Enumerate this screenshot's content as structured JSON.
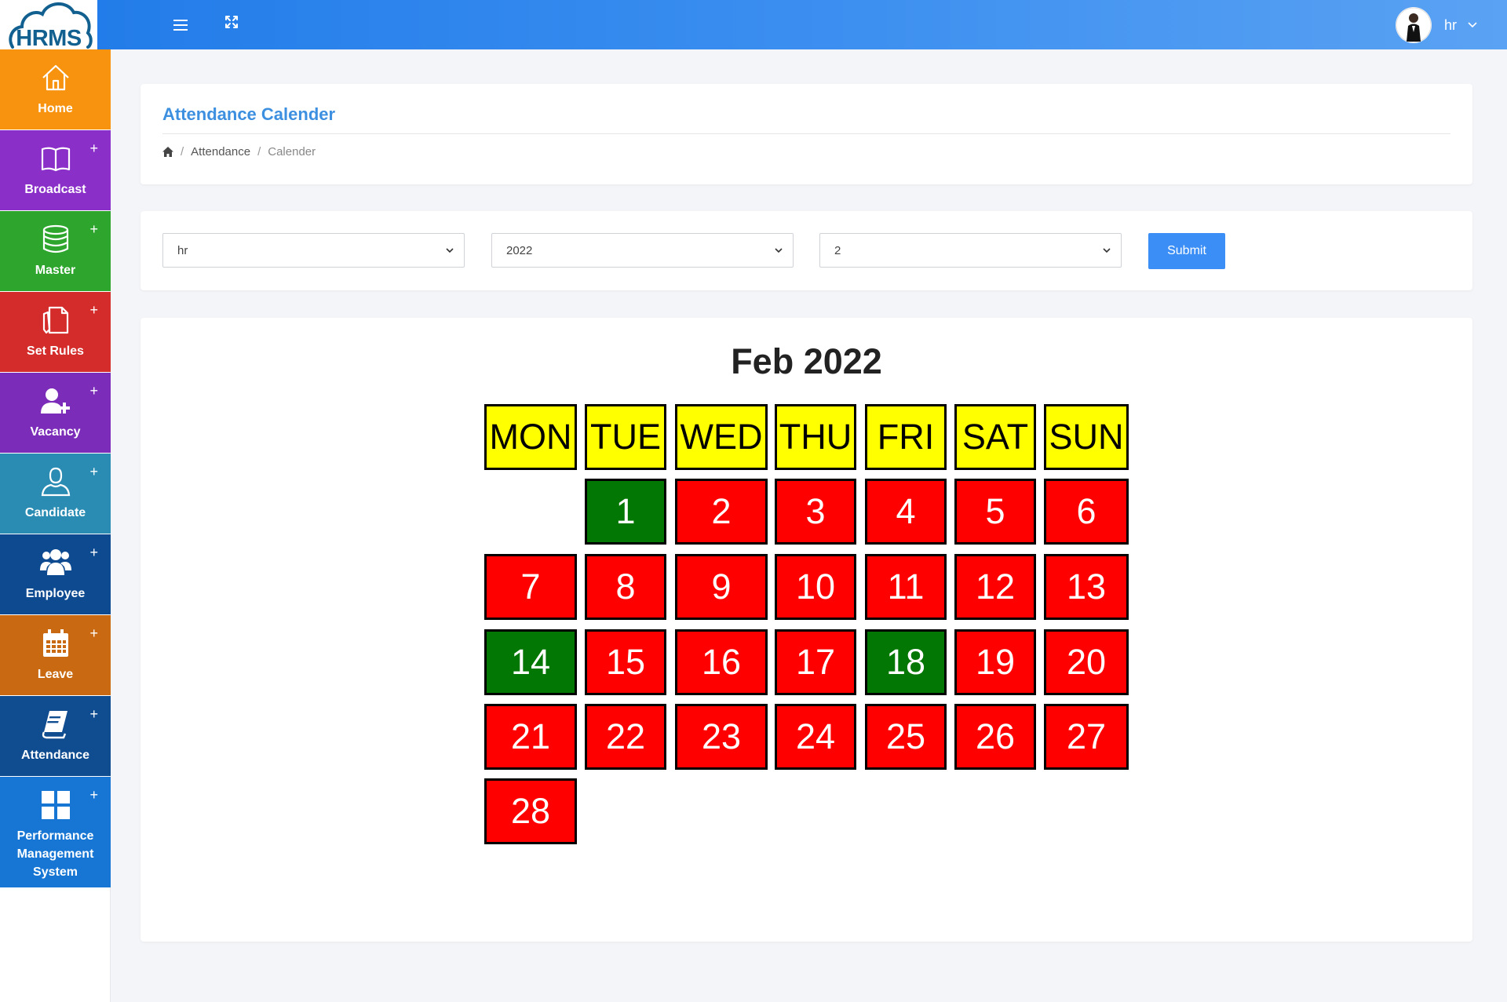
{
  "brand": {
    "logo_text": "HRMS"
  },
  "topbar": {
    "menu_icon": "hamburger-icon",
    "fullscreen_icon": "expand-icon",
    "user_name": "hr",
    "user_caret_icon": "chevron-down-icon"
  },
  "sidebar": {
    "items": [
      {
        "label": "Home",
        "icon": "home-icon",
        "color": "#f7930f",
        "expandable": false
      },
      {
        "label": "Broadcast",
        "icon": "book-icon",
        "color": "#8b2fc9",
        "expandable": true
      },
      {
        "label": "Master",
        "icon": "database-icon",
        "color": "#2ea62e",
        "expandable": true
      },
      {
        "label": "Set Rules",
        "icon": "rules-icon",
        "color": "#d42b2b",
        "expandable": true
      },
      {
        "label": "Vacancy",
        "icon": "user-plus-icon",
        "color": "#7b2cb8",
        "expandable": true
      },
      {
        "label": "Candidate",
        "icon": "user-icon",
        "color": "#2a8cb3",
        "expandable": true
      },
      {
        "label": "Employee",
        "icon": "users-icon",
        "color": "#0e4a8f",
        "expandable": true
      },
      {
        "label": "Leave",
        "icon": "calendar-icon",
        "color": "#c96a12",
        "expandable": true
      },
      {
        "label": "Attendance",
        "icon": "notebook-icon",
        "color": "#0f4c90",
        "expandable": true
      },
      {
        "label": "Performance Management System",
        "icon": "grid-icon",
        "color": "#1776d4",
        "expandable": true
      }
    ],
    "plus_symbol": "+"
  },
  "header_card": {
    "title": "Attendance Calender",
    "breadcrumb": {
      "home_icon": "home-icon",
      "sep": "/",
      "items": [
        "Attendance",
        "Calender"
      ]
    }
  },
  "filter_card": {
    "employee_select": "hr",
    "year_select": "2022",
    "month_select": "2",
    "submit_label": "Submit"
  },
  "calendar": {
    "title": "Feb 2022",
    "weekdays": [
      "MON",
      "TUE",
      "WED",
      "THU",
      "FRI",
      "SAT",
      "SUN"
    ],
    "first_weekday_index": 1,
    "days": [
      {
        "day": "1",
        "status": "present"
      },
      {
        "day": "2",
        "status": "absent"
      },
      {
        "day": "3",
        "status": "absent"
      },
      {
        "day": "4",
        "status": "absent"
      },
      {
        "day": "5",
        "status": "absent"
      },
      {
        "day": "6",
        "status": "absent"
      },
      {
        "day": "7",
        "status": "absent"
      },
      {
        "day": "8",
        "status": "absent"
      },
      {
        "day": "9",
        "status": "absent"
      },
      {
        "day": "10",
        "status": "absent"
      },
      {
        "day": "11",
        "status": "absent"
      },
      {
        "day": "12",
        "status": "absent"
      },
      {
        "day": "13",
        "status": "absent"
      },
      {
        "day": "14",
        "status": "present"
      },
      {
        "day": "15",
        "status": "absent"
      },
      {
        "day": "16",
        "status": "absent"
      },
      {
        "day": "17",
        "status": "absent"
      },
      {
        "day": "18",
        "status": "present"
      },
      {
        "day": "19",
        "status": "absent"
      },
      {
        "day": "20",
        "status": "absent"
      },
      {
        "day": "21",
        "status": "absent"
      },
      {
        "day": "22",
        "status": "absent"
      },
      {
        "day": "23",
        "status": "absent"
      },
      {
        "day": "24",
        "status": "absent"
      },
      {
        "day": "25",
        "status": "absent"
      },
      {
        "day": "26",
        "status": "absent"
      },
      {
        "day": "27",
        "status": "absent"
      },
      {
        "day": "28",
        "status": "absent"
      }
    ],
    "colors": {
      "present": "#037703",
      "absent": "#ff0000",
      "header": "#ffff00"
    }
  }
}
